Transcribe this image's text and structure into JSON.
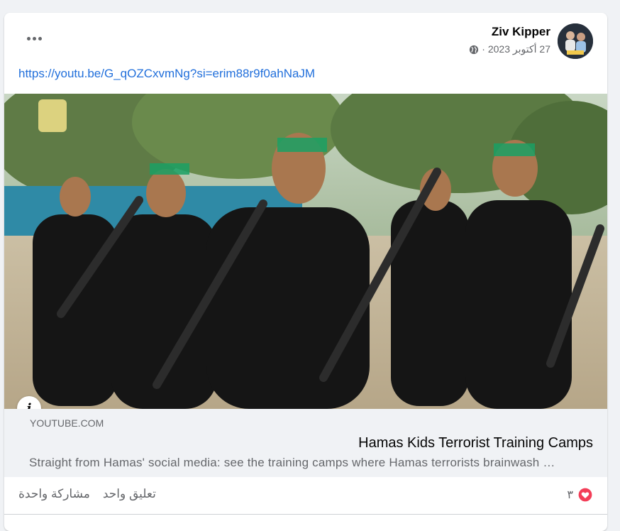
{
  "post": {
    "author": "Ziv Kipper",
    "date": "27 أكتوبر 2023 ·",
    "privacy_icon": "globe-icon",
    "more_icon": "more-horizontal-icon",
    "link_text": "https://youtu.be/G_qOZCxvmNg?si=erim88r9f0ahNaJM"
  },
  "preview": {
    "domain": "YOUTUBE.COM",
    "title": "Hamas Kids Terrorist Training Camps",
    "description": "Straight from Hamas' social media: see the training camps where Hamas terrorists brainwash …",
    "info_icon": "info-icon"
  },
  "engagement": {
    "reaction_icon": "heart-reaction-icon",
    "reaction_count": "٣",
    "comments": "تعليق واحد",
    "shares": "مشاركة واحدة"
  },
  "colors": {
    "link": "#216fdb",
    "heart": "#f33e58",
    "secondary_text": "#65676b",
    "page_bg": "#f0f2f5"
  }
}
